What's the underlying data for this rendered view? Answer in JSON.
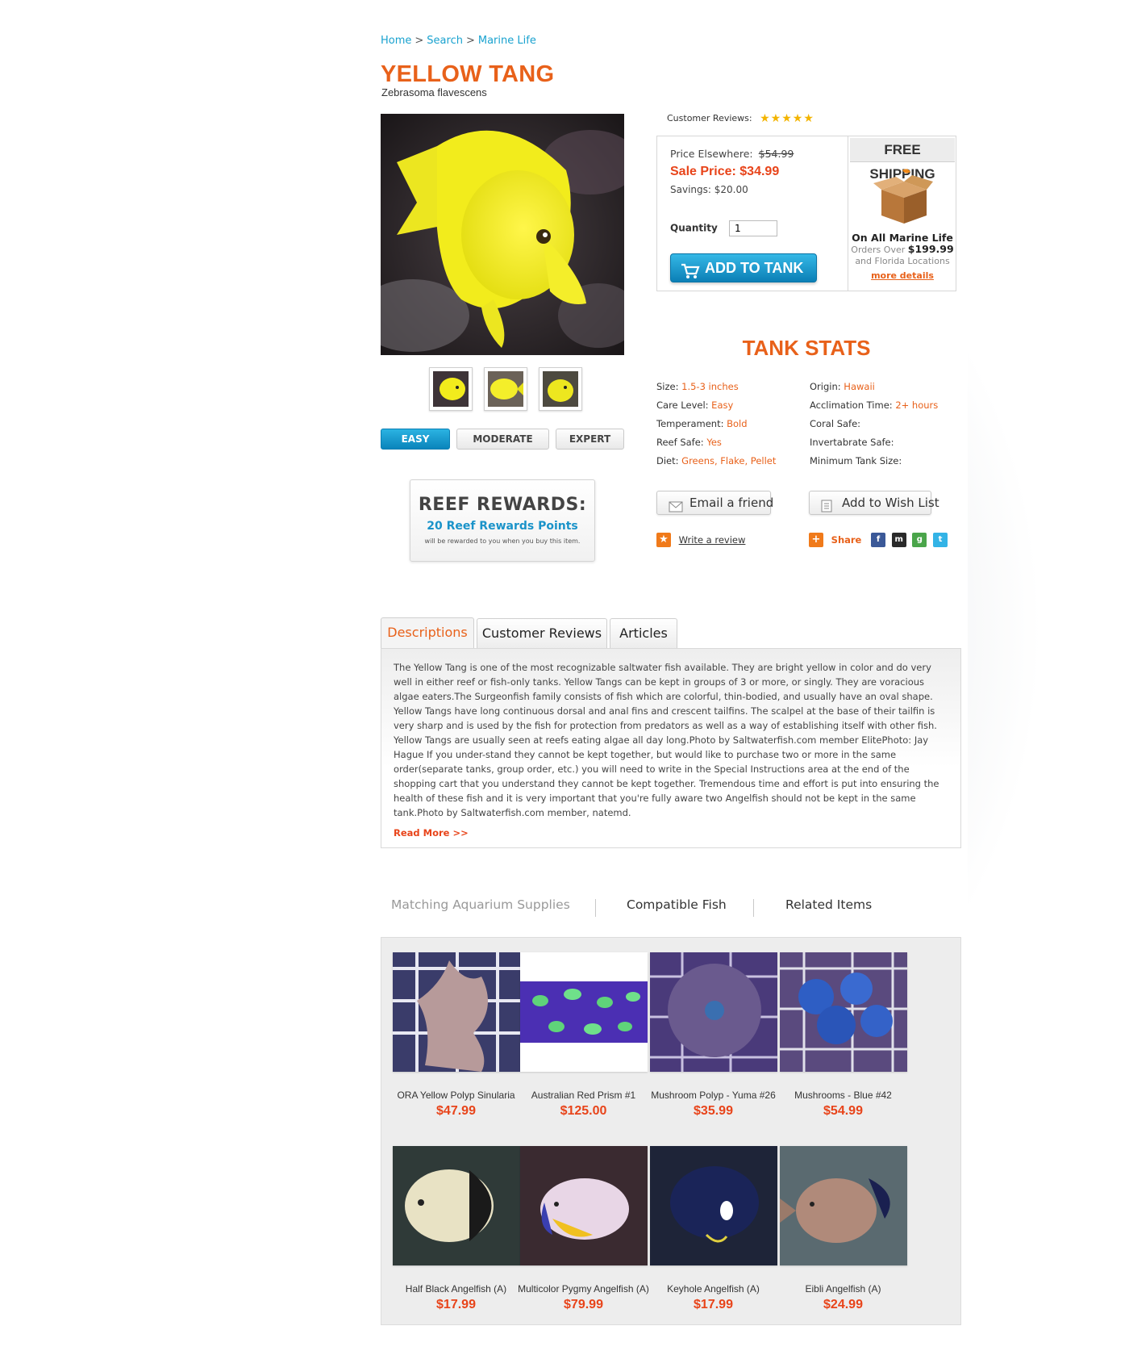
{
  "breadcrumb": {
    "items": [
      "Home",
      "Search",
      "Marine Life"
    ],
    "separator": ">"
  },
  "product": {
    "name": "YELLOW TANG",
    "scientific_name": "Zebrasoma flavescens",
    "reviews_label": "Customer Reviews:",
    "rating": 5,
    "stars": "★★★★★"
  },
  "difficulty": {
    "options": [
      "EASY",
      "MODERATE",
      "EXPERT"
    ],
    "selected": "EASY"
  },
  "rewards": {
    "title": "REEF REWARDS:",
    "points": "20 Reef Rewards Points",
    "subtext": "will be rewarded to you when you buy this item."
  },
  "pricing": {
    "elsewhere_label": "Price Elsewhere:",
    "elsewhere_value": "$54.99",
    "sale_label": "Sale Price:",
    "sale_value": "$34.99",
    "savings_label": "Savings:",
    "savings_value": "$20.00",
    "quantity_label": "Quantity",
    "quantity_value": "1",
    "add_button": "ADD TO TANK"
  },
  "shipping": {
    "title": "FREE SHIPPING",
    "line1": "On All Marine Life",
    "line2_prefix": "Orders Over",
    "line2_amount": "$199.99",
    "line3": "and Florida Locations",
    "link": "more details"
  },
  "tank_stats": {
    "title": "TANK STATS",
    "left": [
      {
        "label": "Size:",
        "value": "1.5-3 inches"
      },
      {
        "label": "Care Level:",
        "value": "Easy"
      },
      {
        "label": "Temperament:",
        "value": "Bold"
      },
      {
        "label": "Reef Safe:",
        "value": "Yes"
      },
      {
        "label": "Diet:",
        "value": "Greens, Flake, Pellet"
      }
    ],
    "right": [
      {
        "label": "Origin:",
        "value": "Hawaii"
      },
      {
        "label": "Acclimation Time:",
        "value": "2+ hours"
      },
      {
        "label": "Coral Safe:",
        "value": ""
      },
      {
        "label": "Invertabrate Safe:",
        "value": ""
      },
      {
        "label": "Minimum Tank Size:",
        "value": ""
      }
    ]
  },
  "actions": {
    "email": "Email a friend",
    "wishlist": "Add to Wish List",
    "write_review": "Write a review",
    "share": "Share"
  },
  "tabs": {
    "items": [
      "Descriptions",
      "Customer Reviews",
      "Articles"
    ],
    "active": "Descriptions"
  },
  "description": {
    "text": "The Yellow Tang is one of the most recognizable saltwater fish available. They are bright yellow in color and do very well in either reef or fish-only tanks. Yellow Tangs can be kept in groups of 3 or more, or singly. They are voracious algae eaters.The Surgeonfish family consists of fish which are colorful, thin-bodied, and usually have an oval shape. Yellow Tangs have long continuous dorsal and anal fins and crescent tailfins. The scalpel at the base of their tailfin is very sharp and is used by the fish for protection from predators as well as a way of establishing itself with other fish. Yellow Tangs are usually seen at reefs eating algae all day long.Photo by Saltwaterfish.com member ElitePhoto: Jay Hague If you under-stand they cannot be kept together, but would like to purchase two or more in the same order(separate tanks, group order, etc.) you will need to write in the Special Instructions area at the end of the shopping cart that you understand they cannot be kept together. Tremendous time and effort is put into ensuring the health of these fish and it is very important that you're fully aware two Angelfish should not be kept in the same tank.Photo by Saltwaterfish.com member, natemd.",
    "read_more": "Read More >>"
  },
  "related_tabs": {
    "items": [
      "Matching Aquarium Supplies",
      "Compatible Fish",
      "Related Items"
    ],
    "muted": "Matching Aquarium Supplies"
  },
  "related_products": [
    {
      "name": "ORA Yellow Polyp Sinularia",
      "price": "$47.99"
    },
    {
      "name": "Australian Red Prism #1",
      "price": "$125.00"
    },
    {
      "name": "Mushroom Polyp - Yuma #26",
      "price": "$35.99"
    },
    {
      "name": "Mushrooms - Blue #42",
      "price": "$54.99"
    },
    {
      "name": "Half Black Angelfish (A)",
      "price": "$17.99"
    },
    {
      "name": "Multicolor Pygmy Angelfish (A)",
      "price": "$79.99"
    },
    {
      "name": "Keyhole Angelfish (A)",
      "price": "$17.99"
    },
    {
      "name": "Eibli Angelfish (A)",
      "price": "$24.99"
    }
  ],
  "colors": {
    "accent_orange": "#e8611a",
    "link_blue": "#19a2cf",
    "button_blue": "#0b7fb6",
    "sale_red": "#e8441a"
  }
}
